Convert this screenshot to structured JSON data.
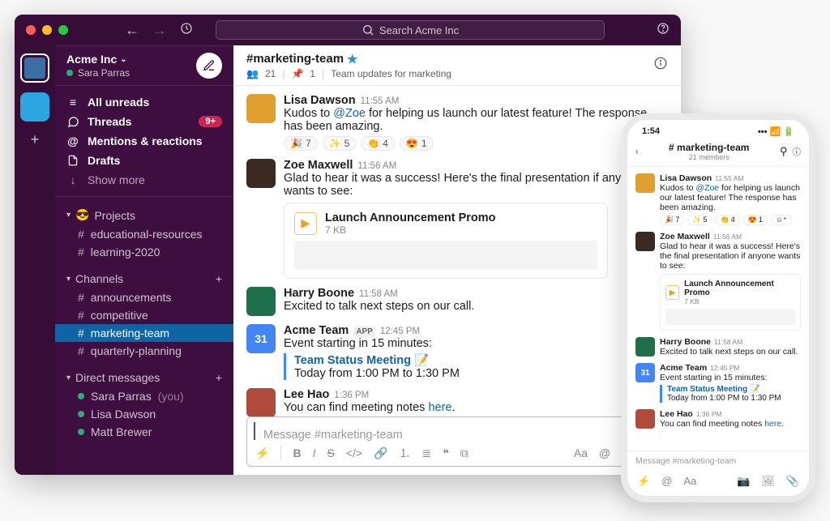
{
  "search": {
    "placeholder": "Search Acme Inc"
  },
  "workspace": {
    "name": "Acme Inc",
    "user": "Sara Parras"
  },
  "sidebar": {
    "nav": {
      "unreads": "All unreads",
      "threads": "Threads",
      "threads_badge": "9+",
      "mentions": "Mentions & reactions",
      "drafts": "Drafts",
      "showmore": "Show more"
    },
    "sections": {
      "projects": {
        "label": "Projects",
        "items": [
          "educational-resources",
          "learning-2020"
        ]
      },
      "channels": {
        "label": "Channels",
        "items": [
          "announcements",
          "competitive",
          "marketing-team",
          "quarterly-planning"
        ]
      },
      "dms": {
        "label": "Direct messages",
        "items": [
          {
            "name": "Sara Parras",
            "suffix": "(you)"
          },
          {
            "name": "Lisa Dawson",
            "suffix": ""
          },
          {
            "name": "Matt Brewer",
            "suffix": ""
          }
        ]
      }
    }
  },
  "channel": {
    "name": "#marketing-team",
    "members": "21",
    "pins": "1",
    "topic": "Team updates for marketing"
  },
  "messages": [
    {
      "author": "Lisa Dawson",
      "time": "11:55 AM",
      "text_pre": "Kudos to ",
      "mention": "@Zoe",
      "text_post": " for helping us launch our latest feature! The response has been amazing.",
      "reactions": [
        {
          "e": "🎉",
          "c": "7"
        },
        {
          "e": "✨",
          "c": "5"
        },
        {
          "e": "👏",
          "c": "4"
        },
        {
          "e": "😍",
          "c": "1"
        }
      ]
    },
    {
      "author": "Zoe Maxwell",
      "time": "11:56 AM",
      "text": "Glad to hear it was a success! Here's the final presentation if anyone wants to see:",
      "file": {
        "title": "Launch Announcement Promo",
        "meta": "7 KB"
      }
    },
    {
      "author": "Harry Boone",
      "time": "11:58 AM",
      "text": "Excited to talk next steps on our call."
    },
    {
      "author": "Acme Team",
      "app": "APP",
      "time": "12:45 PM",
      "text": "Event starting in 15 minutes:",
      "event": {
        "title": "Team Status Meeting",
        "when": "Today from 1:00 PM to 1:30 PM"
      }
    },
    {
      "author": "Lee Hao",
      "time": "1:36 PM",
      "text_pre": "You can find meeting notes ",
      "link": "here",
      "text_post": "."
    }
  ],
  "composer": {
    "placeholder": "Message #marketing-team"
  },
  "phone": {
    "clock": "1:54",
    "channel": "# marketing-team",
    "members": "21 members",
    "composer_placeholder": "Message #marketing-team"
  }
}
